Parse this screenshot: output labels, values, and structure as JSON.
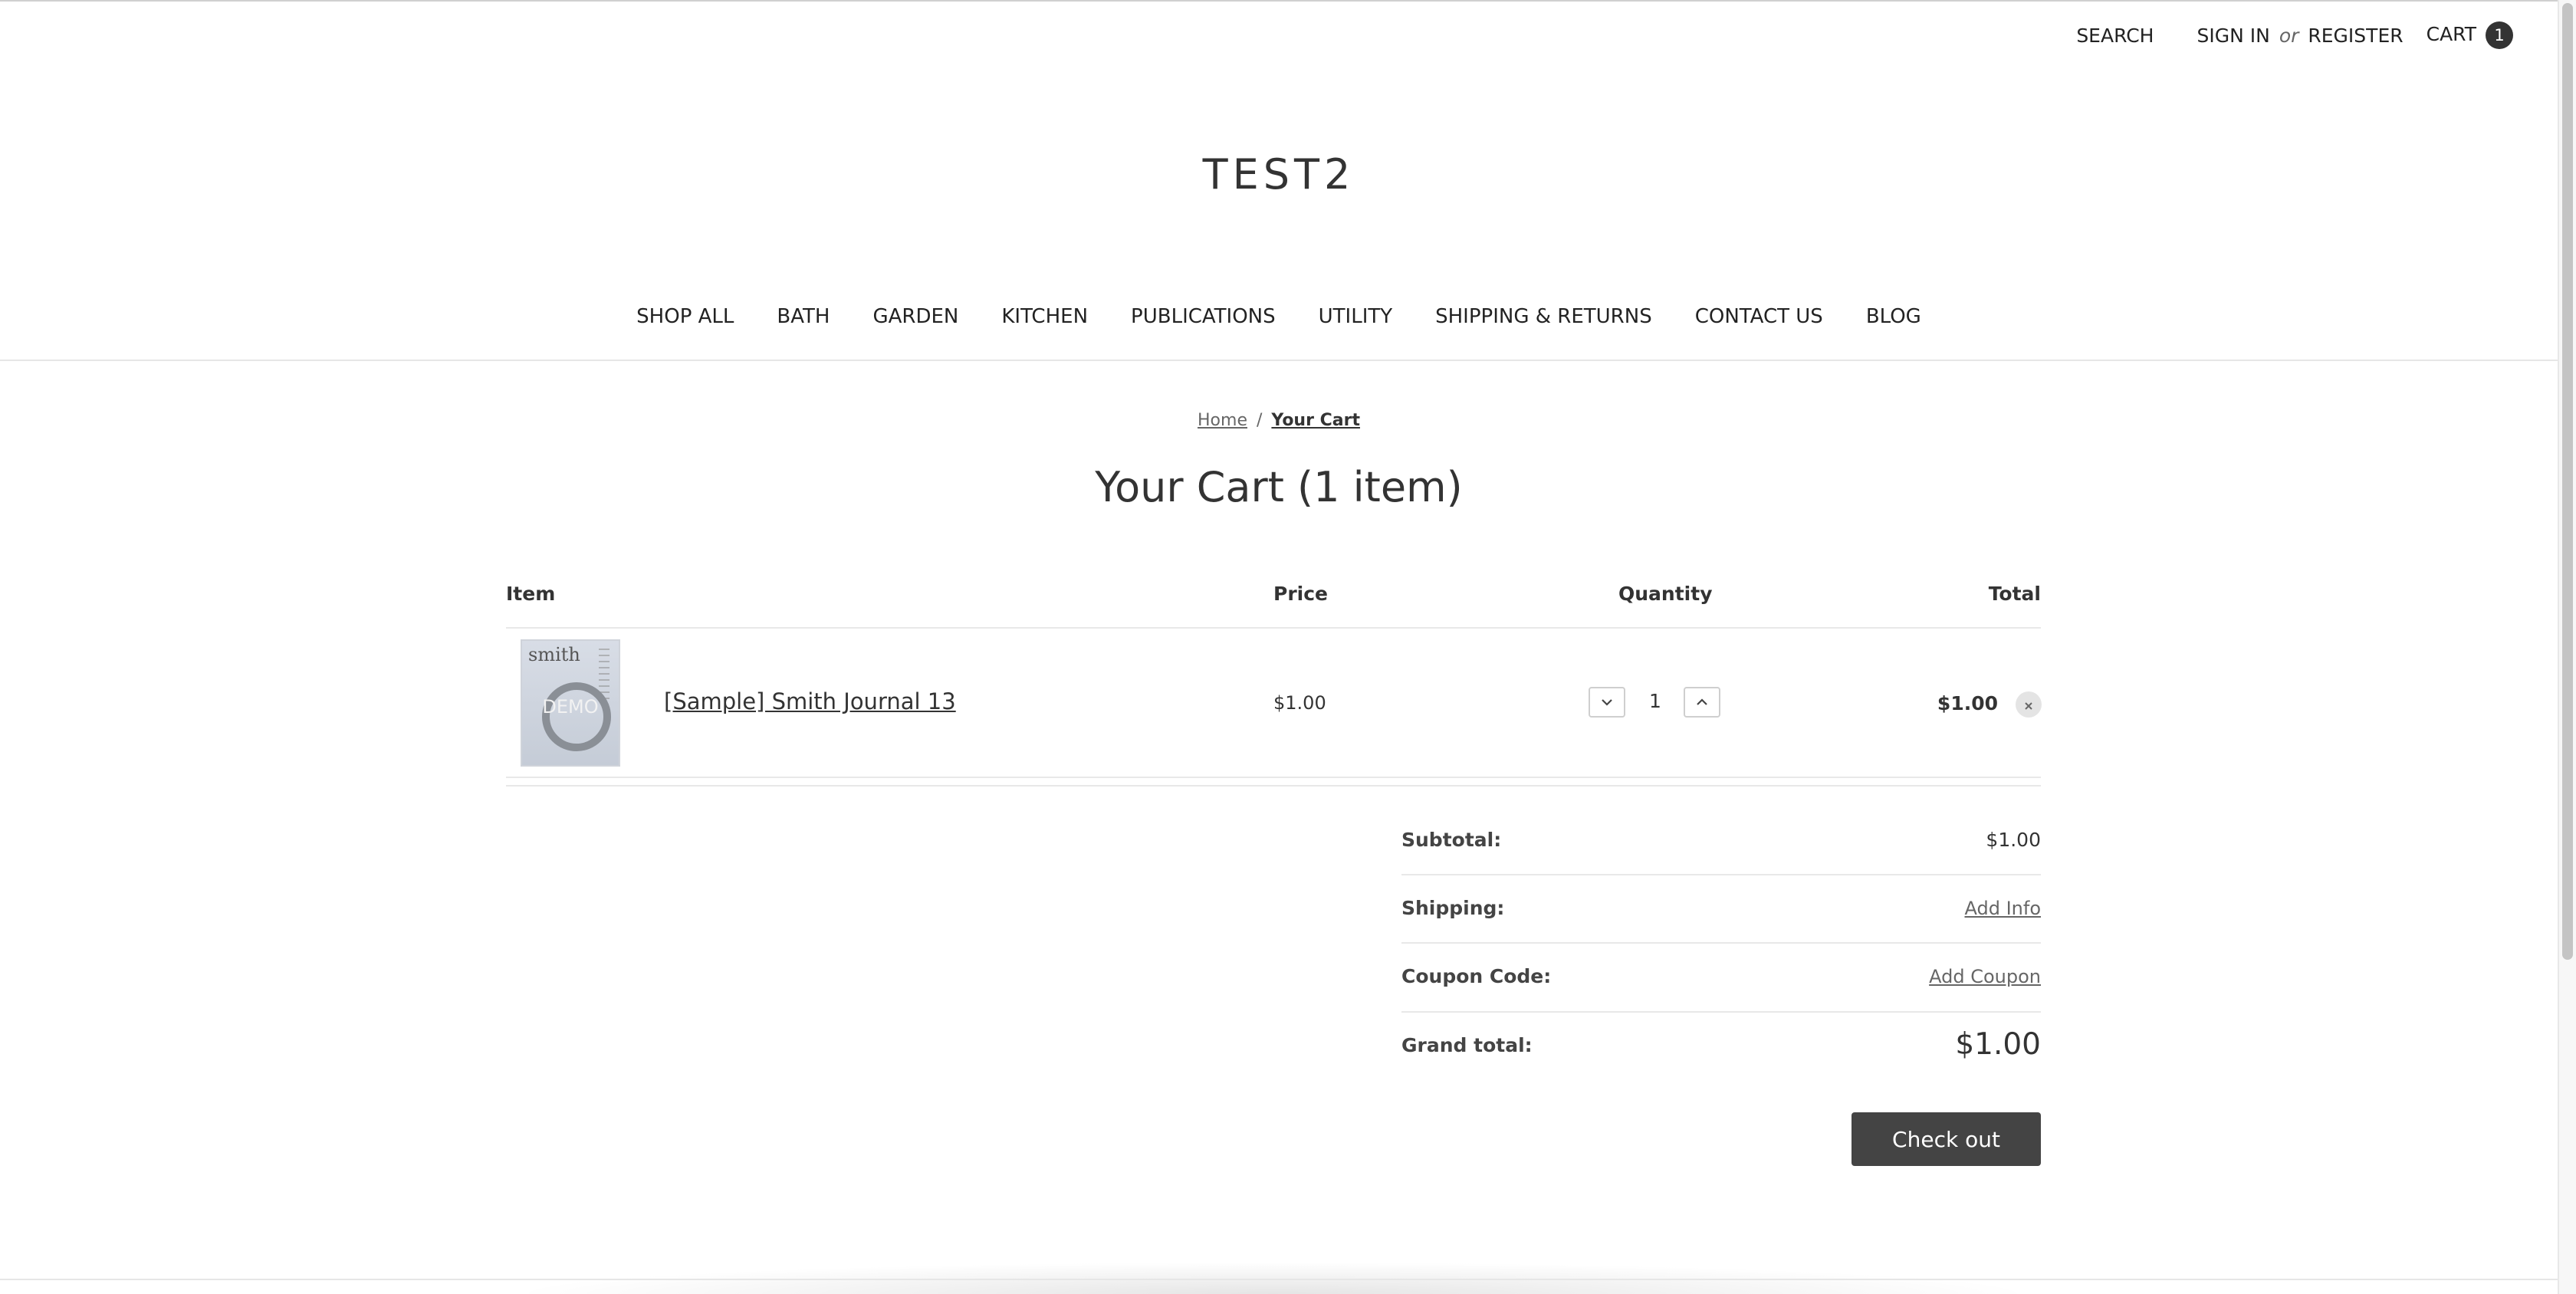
{
  "header": {
    "search_label": "SEARCH",
    "sign_in_label": "SIGN IN",
    "or_text": "or",
    "register_label": "REGISTER",
    "cart_label": "CART",
    "cart_count": "1"
  },
  "store_name": "TEST2",
  "nav": {
    "items": [
      "SHOP ALL",
      "BATH",
      "GARDEN",
      "KITCHEN",
      "PUBLICATIONS",
      "UTILITY",
      "SHIPPING & RETURNS",
      "CONTACT US",
      "BLOG"
    ]
  },
  "breadcrumb": {
    "home": "Home",
    "separator": "/",
    "current": "Your Cart"
  },
  "page_title": "Your Cart (1 item)",
  "cart_table": {
    "headers": {
      "item": "Item",
      "price": "Price",
      "quantity": "Quantity",
      "total": "Total"
    },
    "rows": [
      {
        "thumbnail_brand": "smith",
        "thumbnail_overlay": "DEMO",
        "name": "[Sample] Smith Journal 13",
        "price": "$1.00",
        "quantity": "1",
        "total": "$1.00"
      }
    ]
  },
  "summary": {
    "subtotal_label": "Subtotal:",
    "subtotal_value": "$1.00",
    "shipping_label": "Shipping:",
    "shipping_action": "Add Info",
    "coupon_label": "Coupon Code:",
    "coupon_action": "Add Coupon",
    "grand_total_label": "Grand total:",
    "grand_total_value": "$1.00"
  },
  "checkout_label": "Check out",
  "icons": {
    "decrease": "chevron-down-icon",
    "increase": "chevron-up-icon",
    "remove": "close-icon"
  },
  "colors": {
    "text": "#333333",
    "button_dark": "#444444",
    "badge": "#333333",
    "rule": "#e8e8e8"
  }
}
